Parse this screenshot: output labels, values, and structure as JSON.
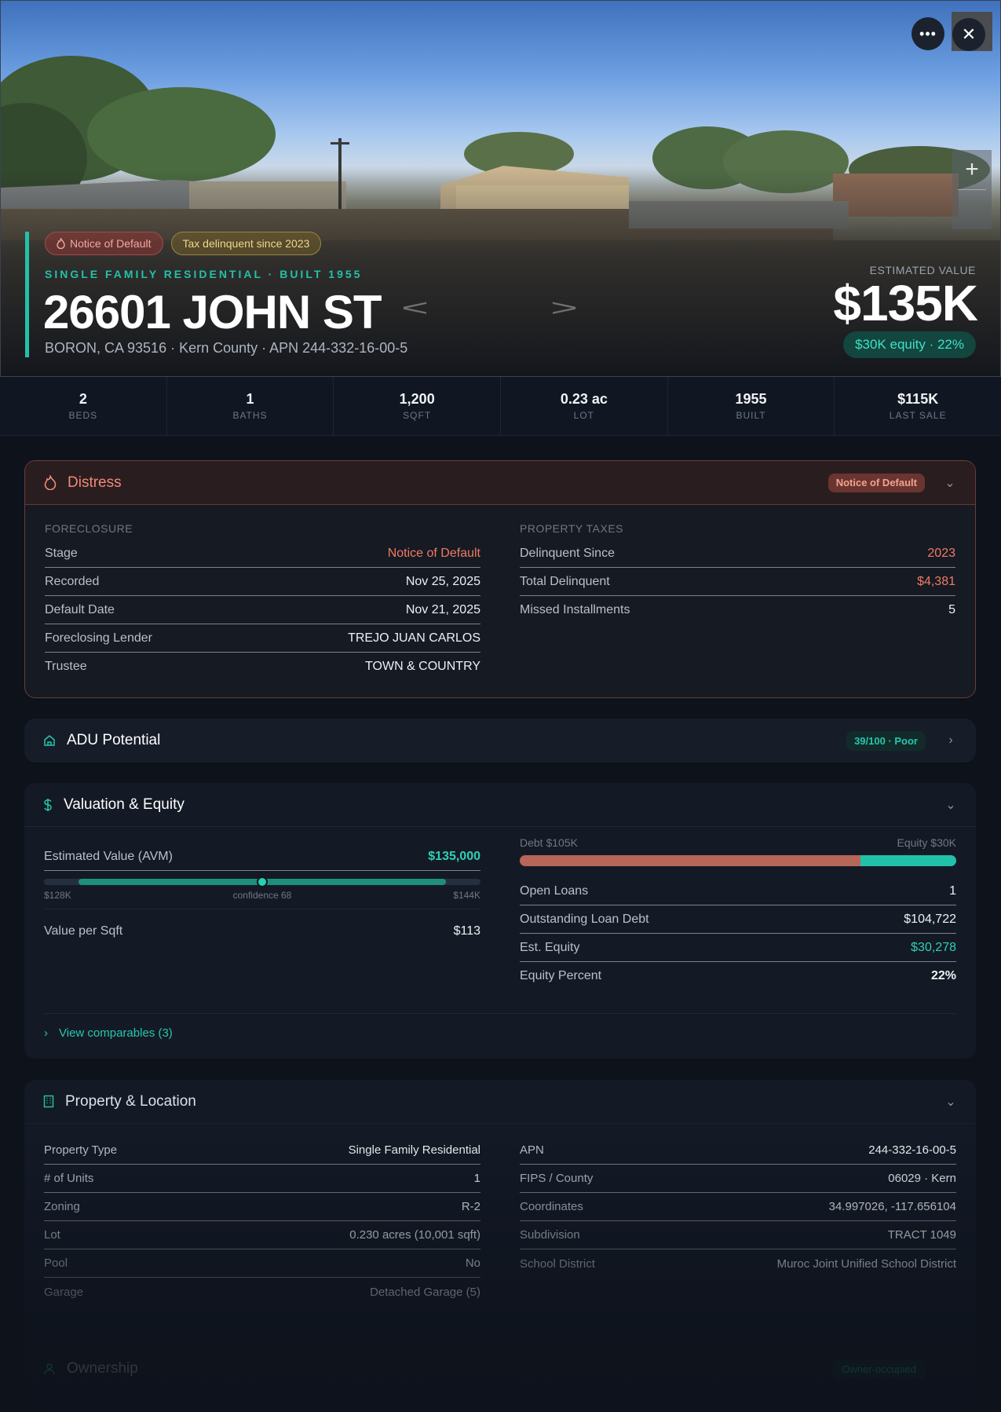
{
  "hero": {
    "tags": [
      {
        "label": "Notice of Default",
        "icon": "flame-icon"
      },
      {
        "label": "Tax delinquent since 2023"
      }
    ],
    "eyebrow": "SINGLE FAMILY RESIDENTIAL · BUILT 1955",
    "address": "26601 JOHN ST",
    "subaddress": "BORON, CA 93516 · Kern County · APN 244-332-16-00-5",
    "estimated_label": "ESTIMATED VALUE",
    "estimated_value": "$135K",
    "equity_pill": "$30K equity · 22%",
    "zoom_plus": "+",
    "more_label": "•••",
    "close_label": "✕",
    "prev_arrow": "<",
    "next_arrow": ">"
  },
  "stats": [
    {
      "value": "2",
      "label": "BEDS"
    },
    {
      "value": "1",
      "label": "BATHS"
    },
    {
      "value": "1,200",
      "label": "SQFT"
    },
    {
      "value": "0.23 ac",
      "label": "LOT"
    },
    {
      "value": "1955",
      "label": "BUILT"
    },
    {
      "value": "$115K",
      "label": "LAST SALE"
    }
  ],
  "distress": {
    "title": "Distress",
    "badge": "Notice of Default",
    "foreclosure_label": "FORECLOSURE",
    "foreclosure_rows": [
      {
        "k": "Stage",
        "v": "Notice of Default"
      },
      {
        "k": "Recorded",
        "v": "Nov 25, 2025"
      },
      {
        "k": "Default Date",
        "v": "Nov 21, 2025"
      },
      {
        "k": "Foreclosing Lender",
        "v": "TREJO JUAN CARLOS"
      },
      {
        "k": "Trustee",
        "v": "TOWN & COUNTRY"
      }
    ],
    "taxes_label": "PROPERTY TAXES",
    "tax_rows": [
      {
        "k": "Delinquent Since",
        "v": "2023"
      },
      {
        "k": "Total Delinquent",
        "v": "$4,381"
      },
      {
        "k": "Missed Installments",
        "v": "5"
      }
    ]
  },
  "adu": {
    "title": "ADU Potential",
    "score": "39/100 · Poor"
  },
  "valuation": {
    "title": "Valuation & Equity",
    "avm_label": "Estimated Value (AVM)",
    "avm_value": "$135,000",
    "range_low": "$128K",
    "range_high": "$144K",
    "confidence": "confidence 68",
    "value_per_sqft_label": "Value per Sqft",
    "value_per_sqft": "$113",
    "debt_label": "Debt $105K",
    "equity_label": "Equity $30K",
    "debt_fraction": 0.78,
    "equity_fraction": 0.22,
    "rows": [
      {
        "k": "Open Loans",
        "v": "1"
      },
      {
        "k": "Outstanding Loan Debt",
        "v": "$104,722"
      },
      {
        "k": "Est. Equity",
        "v": "$30,278"
      },
      {
        "k": "Equity Percent",
        "v": "22%"
      }
    ],
    "comparables": "View comparables (3)"
  },
  "property": {
    "title": "Property & Location",
    "left_rows": [
      {
        "k": "Property Type",
        "v": "Single Family Residential"
      },
      {
        "k": "# of Units",
        "v": "1"
      },
      {
        "k": "Zoning",
        "v": "R-2"
      },
      {
        "k": "Lot",
        "v": "0.230 acres (10,001 sqft)"
      },
      {
        "k": "Pool",
        "v": "No"
      },
      {
        "k": "Garage",
        "v": "Detached Garage (5)"
      }
    ],
    "right_rows": [
      {
        "k": "APN",
        "v": "244-332-16-00-5"
      },
      {
        "k": "FIPS / County",
        "v": "06029 · Kern"
      },
      {
        "k": "Coordinates",
        "v": "34.997026, -117.656104"
      },
      {
        "k": "Subdivision",
        "v": "TRACT 1049"
      },
      {
        "k": "School District",
        "v": "Muroc Joint Unified School District"
      }
    ]
  },
  "ownership": {
    "title": "Ownership",
    "badge": "Owner-occupied"
  },
  "colors": {
    "accent": "#22c1a9",
    "distress": "#f07a63",
    "background": "#0d121b"
  }
}
